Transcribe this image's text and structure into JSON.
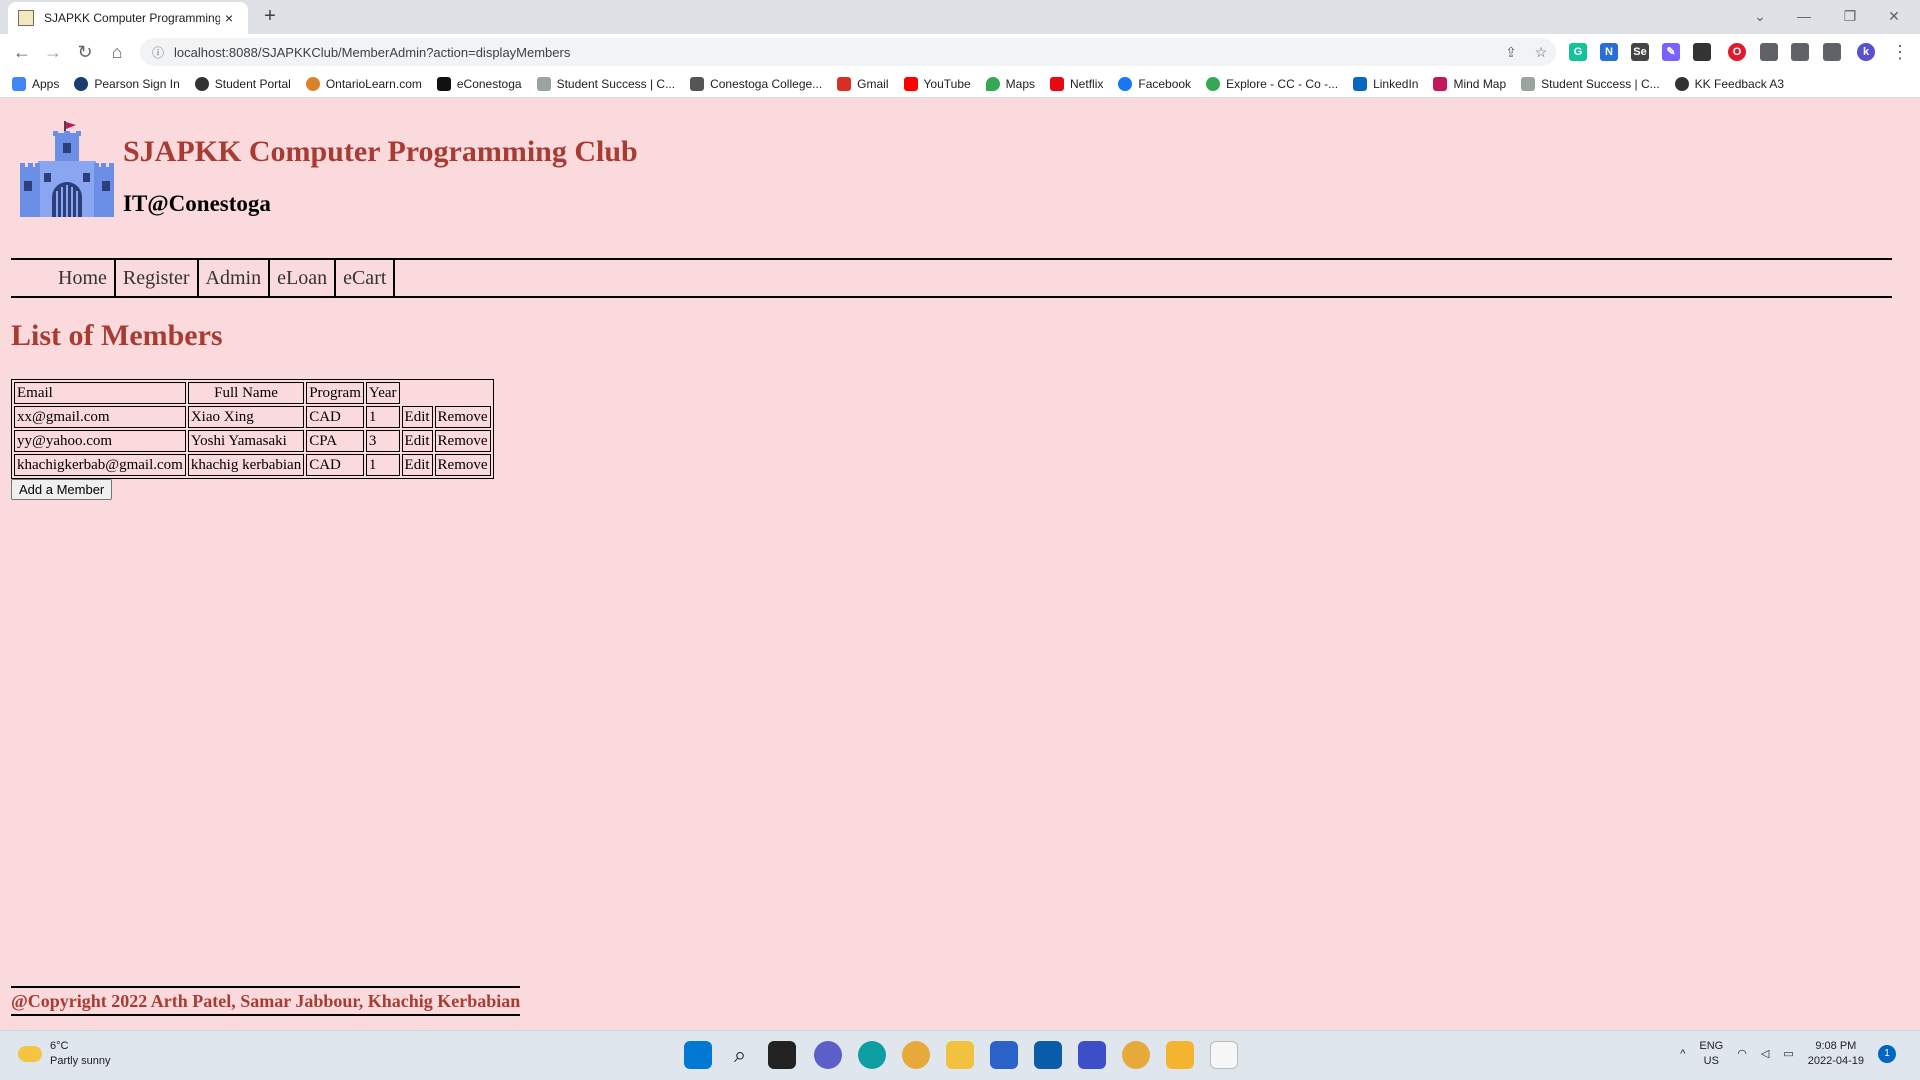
{
  "browser": {
    "tab_title": "SJAPKK Computer Programming",
    "tab_close": "×",
    "new_tab": "+",
    "url": "localhost:8088/SJAPKKClub/MemberAdmin?action=displayMembers",
    "extensions": [
      "G",
      "N",
      "Se",
      "✎",
      "O"
    ],
    "profile_initial": "k",
    "bookmarks": [
      {
        "label": "Apps",
        "color": "#4285f4"
      },
      {
        "label": "Pearson Sign In",
        "color": "#1a3c6e"
      },
      {
        "label": "Student Portal",
        "color": "#333333"
      },
      {
        "label": "OntarioLearn.com",
        "color": "#d9822b"
      },
      {
        "label": "eConestoga",
        "color": "#111111"
      },
      {
        "label": "Student Success | C...",
        "color": "#9aa39c"
      },
      {
        "label": "Conestoga College...",
        "color": "#555555"
      },
      {
        "label": "Gmail",
        "color": "#d93025"
      },
      {
        "label": "YouTube",
        "color": "#ff0000"
      },
      {
        "label": "Maps",
        "color": "#34a853"
      },
      {
        "label": "Netflix",
        "color": "#e50914"
      },
      {
        "label": "Facebook",
        "color": "#1877f2"
      },
      {
        "label": "Explore - CC - Co -...",
        "color": "#34a853"
      },
      {
        "label": "LinkedIn",
        "color": "#0a66c2"
      },
      {
        "label": "Mind Map",
        "color": "#c2185b"
      },
      {
        "label": "Student Success | C...",
        "color": "#9aa39c"
      },
      {
        "label": "KK Feedback A3",
        "color": "#333333"
      }
    ]
  },
  "site": {
    "title": "SJAPKK Computer Programming Club",
    "subtitle": "IT@Conestoga",
    "nav": [
      "Home",
      "Register",
      "Admin",
      "eLoan",
      "eCart"
    ],
    "heading": "List of Members",
    "table": {
      "headers": [
        "Email",
        "Full Name",
        "Program",
        "Year"
      ],
      "rows": [
        {
          "email": "xx@gmail.com",
          "name": "Xiao Xing",
          "program": "CAD",
          "year": "1",
          "edit": "Edit",
          "remove": "Remove"
        },
        {
          "email": "yy@yahoo.com",
          "name": "Yoshi Yamasaki",
          "program": "CPA",
          "year": "3",
          "edit": "Edit",
          "remove": "Remove"
        },
        {
          "email": "khachigkerbab@gmail.com",
          "name": "khachig kerbabian",
          "program": "CAD",
          "year": "1",
          "edit": "Edit",
          "remove": "Remove"
        }
      ]
    },
    "add_button": "Add a Member",
    "copyright": "@Copyright 2022 Arth Patel, Samar Jabbour, Khachig Kerbabian",
    "title_color": "#a83c32",
    "background": "#fadadd"
  },
  "taskbar": {
    "temperature": "6°C",
    "weather": "Partly sunny",
    "language": "ENG",
    "region": "US",
    "time": "9:08 PM",
    "date": "2022-04-19",
    "notifications": "1"
  }
}
